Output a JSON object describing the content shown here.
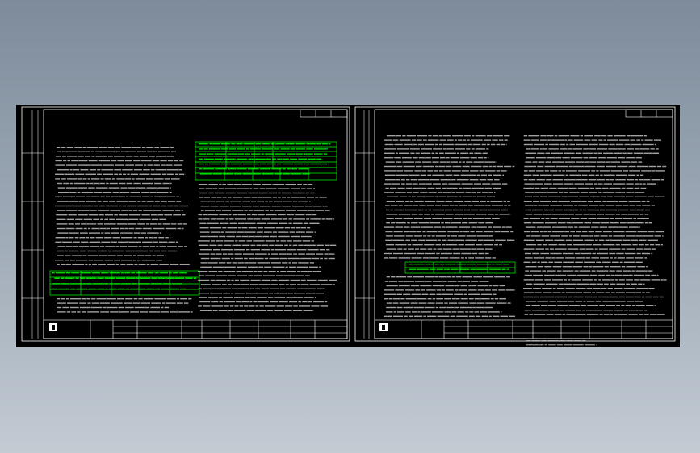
{
  "viewer": {
    "background_top": "#7d8b9b",
    "background_bottom": "#c3cbd3",
    "canvas_color": "#000000",
    "line_color": "#ffffff",
    "table_color": "#00ff00"
  },
  "sheets": [
    {
      "title_text": "",
      "company_text": "",
      "drawing_name": "",
      "page_mark": ""
    },
    {
      "title_text": "",
      "company_text": "",
      "drawing_name": "",
      "page_mark": ""
    }
  ]
}
